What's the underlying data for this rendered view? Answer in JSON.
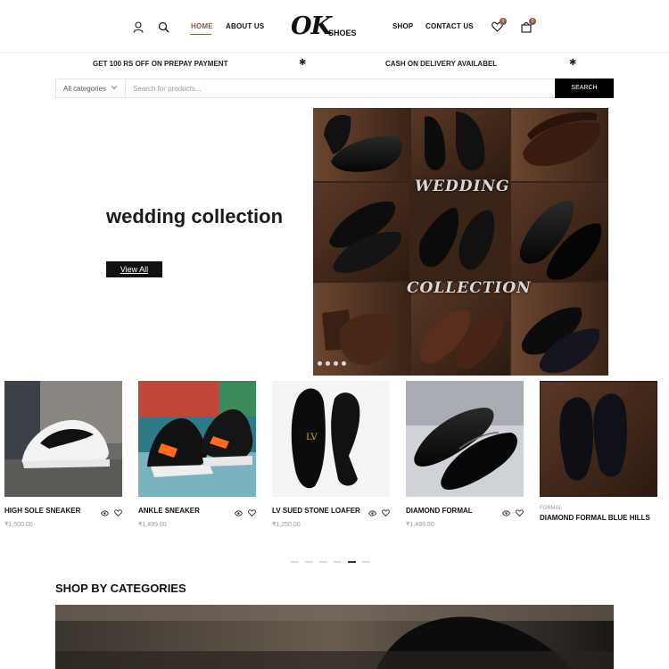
{
  "header": {
    "nav_left": [
      {
        "label": "HOME",
        "active": true
      },
      {
        "label": "ABOUT US",
        "active": false
      }
    ],
    "nav_right": [
      {
        "label": "SHOP"
      },
      {
        "label": "CONTACT US"
      }
    ],
    "logo": {
      "main": "OK",
      "sub": "SHOES"
    },
    "wishlist_count": "0",
    "cart_count": "0",
    "icons": [
      "user-icon",
      "search-icon",
      "heart-icon",
      "bag-icon"
    ]
  },
  "announcement": {
    "items": [
      "GET 100 RS OFF ON PREPAY PAYMENT",
      "CASH ON DELIVERY AVAILABEL"
    ],
    "separator": "✱"
  },
  "search": {
    "category": "All categories",
    "placeholder": "Search for products...",
    "button": "SEARCH"
  },
  "hero": {
    "title": "wedding collection",
    "button": "View All",
    "overlay_top": "WEDDING",
    "overlay_bottom": "COLLECTION"
  },
  "products": [
    {
      "name": "HIGH SOLE SNEAKER",
      "price": "₹1,500.00"
    },
    {
      "name": "ANKLE SNEAKER",
      "price": "₹1,499.00"
    },
    {
      "name": "LV SUED STONE LOAFER",
      "price": "₹1,250.00"
    },
    {
      "name": "DIAMOND FORMAL",
      "price": "₹1,499.00"
    },
    {
      "name": "DIAMOND FORMAL BLUE HILLS",
      "category": "FORMAL"
    }
  ],
  "sections": {
    "categories_title": "SHOP BY CATEGORIES"
  },
  "colors": {
    "accent": "#8a5a4a",
    "button_bg": "#000000",
    "text": "#111111"
  }
}
